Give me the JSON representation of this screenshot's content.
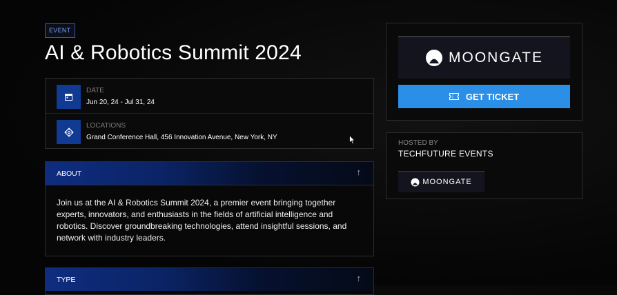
{
  "event": {
    "tag": "EVENT",
    "title": "AI & Robotics Summit 2024"
  },
  "info": {
    "date": {
      "label": "DATE",
      "value": "Jun 20, 24 - Jul 31, 24",
      "icon": "calendar-icon"
    },
    "location": {
      "label": "LOCATIONS",
      "value": "Grand Conference Hall, 456 Innovation Avenue, New York, NY",
      "icon": "location-crosshair-icon"
    }
  },
  "about": {
    "title": "ABOUT",
    "text": "Join us at the AI & Robotics Summit 2024, a premier event bringing together experts, innovators, and enthusiasts in the fields of artificial intelligence and robotics. Discover groundbreaking technologies, attend insightful sessions, and network with industry leaders."
  },
  "type_section": {
    "title": "TYPE"
  },
  "ticket": {
    "logo_text": "MOONGATE",
    "button_label": "GET TICKET"
  },
  "host": {
    "label": "HOSTED BY",
    "name": "TECHFUTURE EVENTS",
    "logo_text": "MOONGATE"
  },
  "colors": {
    "accent_blue": "#2b8fe8",
    "icon_bg": "#113a92",
    "tag_border": "#3d5a9e"
  }
}
